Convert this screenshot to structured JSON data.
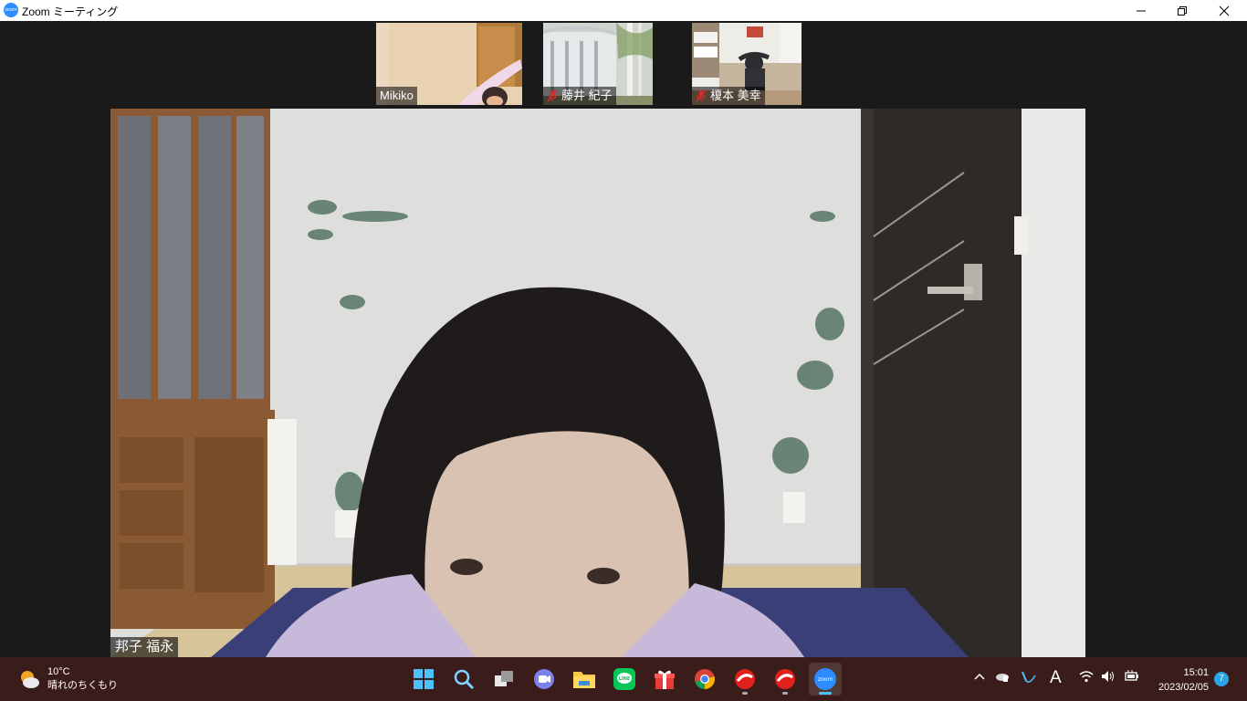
{
  "window": {
    "title": "Zoom ミーティング",
    "app_icon_text": "zoom"
  },
  "participants": [
    {
      "name": "Mikiko",
      "muted": false
    },
    {
      "name": "藤井 紀子",
      "muted": true
    },
    {
      "name": "榎本 美幸",
      "muted": true
    }
  ],
  "active_speaker": {
    "name": "邦子 福永"
  },
  "taskbar": {
    "weather": {
      "temp": "10°C",
      "condition": "晴れのちくもり",
      "icon": "partly-cloudy-icon"
    },
    "apps": [
      {
        "name": "start",
        "icon": "windows-start-icon"
      },
      {
        "name": "search",
        "icon": "search-icon"
      },
      {
        "name": "task-view",
        "icon": "task-view-icon"
      },
      {
        "name": "meet",
        "icon": "video-chat-icon"
      },
      {
        "name": "file-explorer",
        "icon": "folder-icon"
      },
      {
        "name": "line",
        "icon": "line-icon",
        "label": "LINE"
      },
      {
        "name": "gift",
        "icon": "gift-icon"
      },
      {
        "name": "chrome",
        "icon": "chrome-icon"
      },
      {
        "name": "security-1",
        "icon": "trend-micro-icon"
      },
      {
        "name": "security-2",
        "icon": "trend-micro-icon"
      },
      {
        "name": "zoom",
        "icon": "zoom-icon",
        "label": "zoom"
      }
    ],
    "tray": {
      "ime": "A",
      "time": "15:01",
      "date": "2023/02/05",
      "notifications": "7"
    }
  },
  "colors": {
    "zoom_blue": "#2D8CFF",
    "mute_red": "#e02828",
    "taskbar_bg": "#3a1d1a",
    "meeting_bg": "#1a1a1a"
  }
}
